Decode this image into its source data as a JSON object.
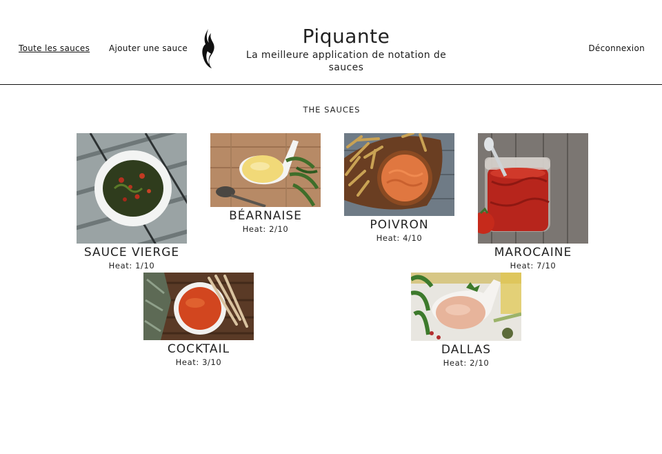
{
  "nav": {
    "all_sauces": "Toute les sauces",
    "add_sauce": "Ajouter une sauce",
    "logout": "Déconnexion"
  },
  "brand": {
    "title": "Piquante",
    "subtitle": "La meilleure application de notation de sauces"
  },
  "section": {
    "title": "THE SAUCES"
  },
  "sauces": [
    {
      "name": "SAUCE VIERGE",
      "heat": "Heat: 1/10",
      "image": "green-herb-sauce-bowl"
    },
    {
      "name": "BÉARNAISE",
      "heat": "Heat: 2/10",
      "image": "bearnaise-spoon"
    },
    {
      "name": "POIVRON",
      "heat": "Heat: 4/10",
      "image": "pepper-dip-bowl"
    },
    {
      "name": "MAROCAINE",
      "heat": "Heat: 7/10",
      "image": "tomato-sauce-jar"
    },
    {
      "name": "COCKTAIL",
      "heat": "Heat: 3/10",
      "image": "cocktail-sauce-bowl"
    },
    {
      "name": "DALLAS",
      "heat": "Heat: 2/10",
      "image": "creamy-sauce-bowl"
    }
  ],
  "colors": {
    "text": "#222222",
    "divider": "#111111",
    "background": "#ffffff"
  }
}
